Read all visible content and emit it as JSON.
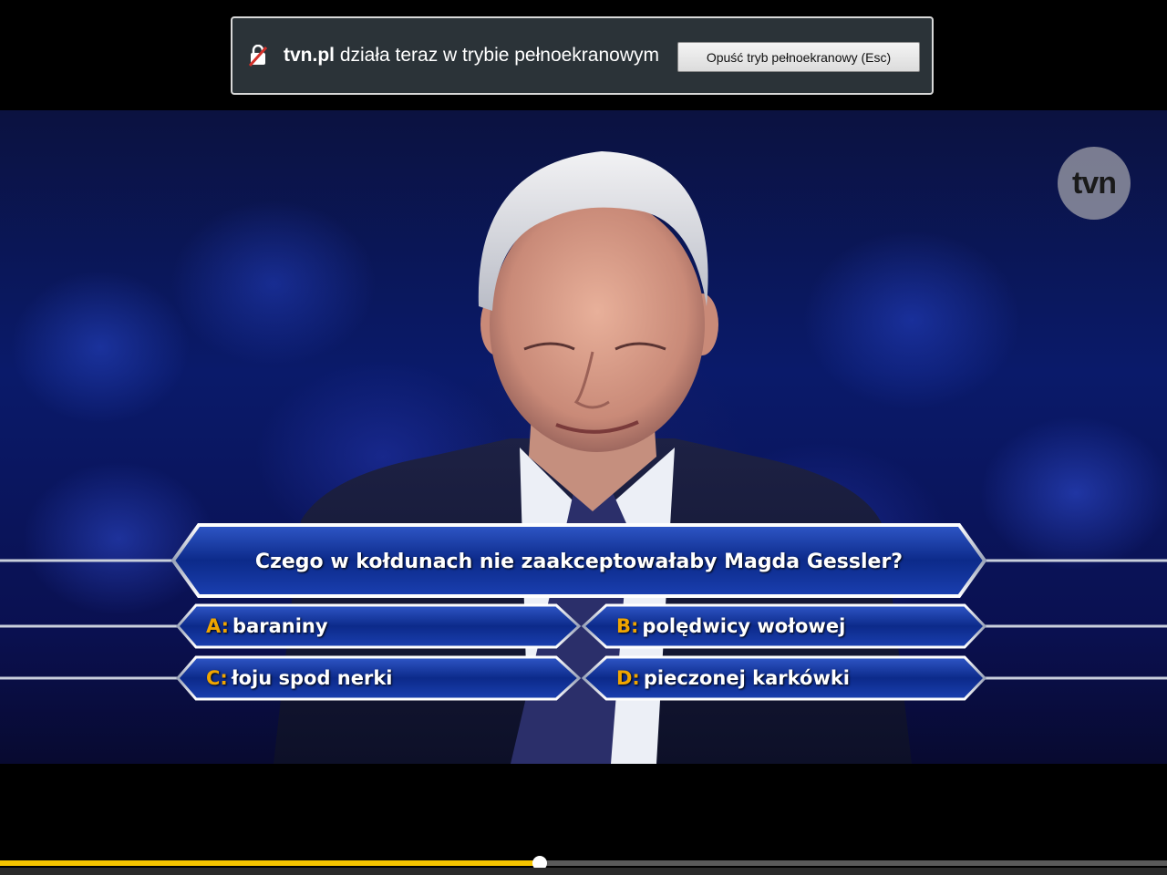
{
  "fullscreen_notice": {
    "domain": "tvn.pl",
    "message": " działa teraz w trybie pełnoekranowym",
    "exit_button_label": "Opuść tryb pełnoekranowy (Esc)"
  },
  "channel_logo": "tvn",
  "quiz": {
    "question": "Czego w kołdunach nie zaakceptowałaby Magda Gessler?",
    "answers": [
      {
        "letter": "A:",
        "text": "baraniny"
      },
      {
        "letter": "B:",
        "text": "polędwicy wołowej"
      },
      {
        "letter": "C:",
        "text": "łoju spod nerki"
      },
      {
        "letter": "D:",
        "text": "pieczonej karkówki"
      }
    ]
  },
  "player": {
    "progress_fraction": 0.4625,
    "colors": {
      "progress_fill": "#f5c400",
      "track": "#5a5a5a"
    }
  }
}
